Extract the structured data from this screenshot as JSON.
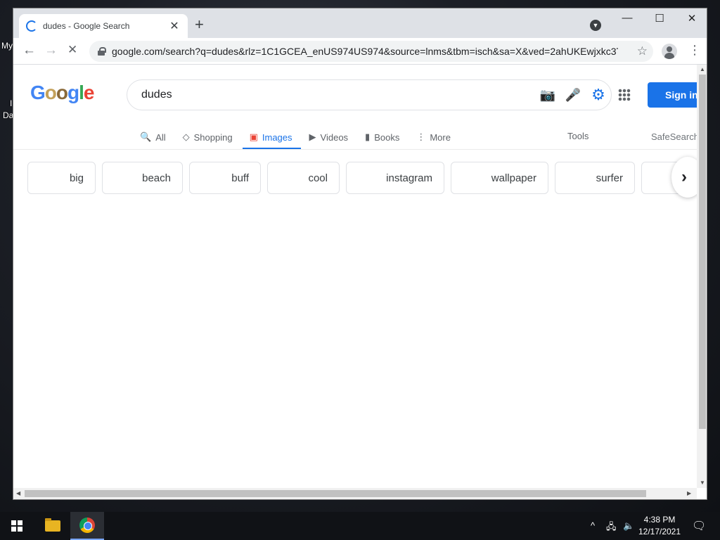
{
  "desktop": {
    "labels": [
      "My",
      "I",
      "Da"
    ]
  },
  "browser": {
    "tab_title": "dudes - Google Search",
    "tab_close": "✕",
    "new_tab": "+",
    "tab_search": "▼",
    "window_controls": {
      "minimize": "—",
      "maximize": "☐",
      "close": "✕"
    },
    "back": "←",
    "forward": "→",
    "reload": "✕",
    "url": "google.com/search?q=dudes&rlz=1C1GCEA_enUS974US974&source=lnms&tbm=isch&sa=X&ved=2ahUKEwjxkc3T...",
    "star": "☆",
    "menu": "⋮"
  },
  "google": {
    "logo": {
      "letters": [
        "G",
        "o",
        "o",
        "g",
        "l",
        "e"
      ],
      "colors": [
        "#4285f4",
        "#c4a15a",
        "#8a6a3a",
        "#4285f4",
        "#34a853",
        "#ea4335"
      ]
    },
    "query": "dudes",
    "search_icons": {
      "camera": "📷",
      "mic": "🎤",
      "settings": "⚙"
    },
    "sign_in": "Sign in",
    "tabs": [
      {
        "icon": "🔍",
        "label": "All"
      },
      {
        "icon": "◇",
        "label": "Shopping"
      },
      {
        "icon": "▣",
        "label": "Images"
      },
      {
        "icon": "▶",
        "label": "Videos"
      },
      {
        "icon": "▮",
        "label": "Books"
      },
      {
        "icon": "⋮",
        "label": "More"
      }
    ],
    "active_tab": "Images",
    "tools": "Tools",
    "safesearch": "SafeSearch",
    "chips": [
      "big",
      "beach",
      "buff",
      "cool",
      "instagram",
      "wallpaper",
      "surfer",
      ""
    ],
    "chips_next": "›"
  },
  "taskbar": {
    "tray_icons": {
      "chevron": "^",
      "network": "🖧",
      "volume": "🔈"
    },
    "time": "4:38 PM",
    "date": "12/17/2021",
    "notifications": "🗨"
  },
  "colors": {
    "accent": "#1a73e8",
    "taskbar": "#101216"
  }
}
